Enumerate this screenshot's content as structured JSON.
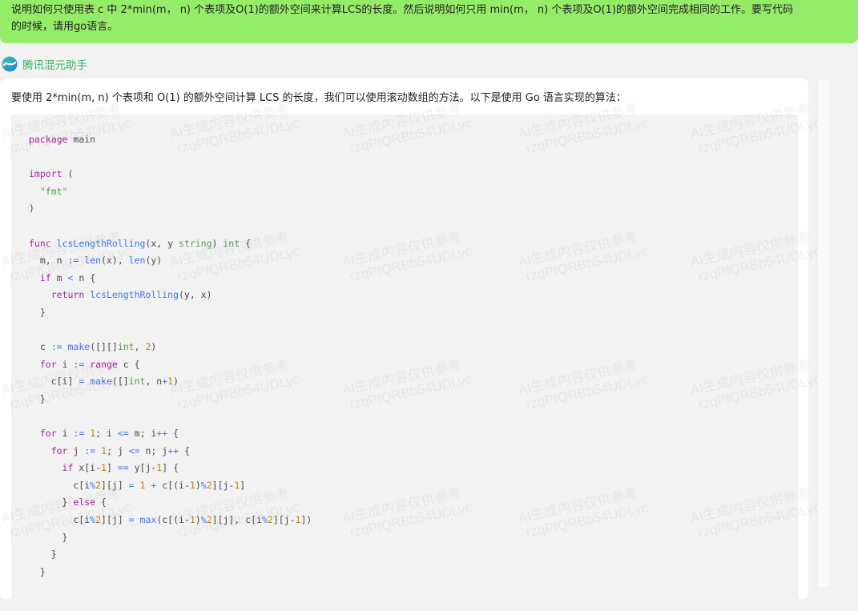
{
  "user_message": {
    "lines": [
      "说明如何只使用表 c 中 2*min(m， n) 个表项及O(1)的额外空间来计算LCS的长度。然后说明如何只用 min(m， n) 个表项及O(1)的额外空间完成相同的工作。要写代码",
      "的时候，请用go语言。"
    ]
  },
  "assistant": {
    "name": "腾讯混元助手",
    "logo_icon": "hunyuan-logo-icon",
    "intro": "要使用 2*min(m, n) 个表项和 O(1) 的额外空间计算 LCS 的长度，我们可以使用滚动数组的方法。以下是使用 Go 语言实现的算法：",
    "code_language": "go",
    "code_lines": [
      "package main",
      "",
      "import (",
      "  \"fmt\"",
      ")",
      "",
      "func lcsLengthRolling(x, y string) int {",
      "  m, n := len(x), len(y)",
      "  if m < n {",
      "    return lcsLengthRolling(y, x)",
      "  }",
      "",
      "  c := make([][]int, 2)",
      "  for i := range c {",
      "    c[i] = make([]int, n+1)",
      "  }",
      "",
      "  for i := 1; i <= m; i++ {",
      "    for j := 1; j <= n; j++ {",
      "      if x[i-1] == y[j-1] {",
      "        c[i%2][j] = 1 + c[(i-1)%2][j-1]",
      "      } else {",
      "        c[i%2][j] = max(c[(i-1)%2][j], c[i%2][j-1])",
      "      }",
      "    }",
      "  }"
    ]
  },
  "watermark": {
    "line1": "AI生成内容仅供参考",
    "line2": "rzqPfQRBb54UDLyc"
  },
  "colors": {
    "user_bubble": "#95ec69",
    "assistant_name": "#31b36b",
    "keyword": "#a626a4",
    "function": "#4078f2",
    "type": "#50a14f",
    "number": "#c18401"
  }
}
